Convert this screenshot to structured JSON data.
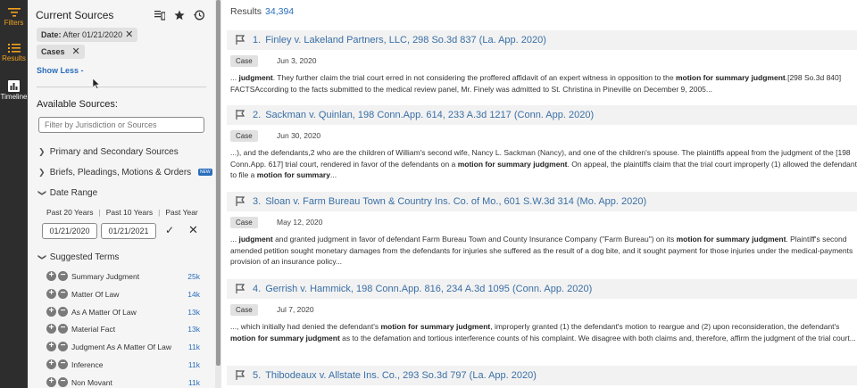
{
  "rail": {
    "items": [
      {
        "label": "Filters",
        "icon": "filter-icon",
        "active": true
      },
      {
        "label": "Results",
        "icon": "list-icon",
        "active": true
      },
      {
        "label": "Timeline",
        "icon": "chart-icon",
        "active": false
      }
    ]
  },
  "panel": {
    "title": "Current Sources",
    "chips": [
      {
        "label_bold": "Date:",
        "label": " After 01/21/2020"
      },
      {
        "label_bold": "Cases",
        "label": ""
      }
    ],
    "show_less": "Show Less -",
    "available_title": "Available Sources:",
    "filter_placeholder": "Filter by Jurisdiction or Sources",
    "accordions": [
      {
        "label": "Primary and Secondary Sources",
        "open": false
      },
      {
        "label": "Briefs, Pleadings, Motions & Orders",
        "open": false,
        "badge": "NEW"
      },
      {
        "label": "Date Range",
        "open": true
      }
    ],
    "date_range": {
      "links": [
        "Past 20 Years",
        "Past 10 Years",
        "Past Year"
      ],
      "from": "01/21/2020",
      "to": "01/21/2021"
    },
    "suggested": {
      "label": "Suggested Terms",
      "terms": [
        {
          "name": "Summary Judgment",
          "count": "25k"
        },
        {
          "name": "Matter Of Law",
          "count": "14k"
        },
        {
          "name": "As A Matter Of Law",
          "count": "13k"
        },
        {
          "name": "Material Fact",
          "count": "13k"
        },
        {
          "name": "Judgment As A Matter Of Law",
          "count": "11k"
        },
        {
          "name": "Inference",
          "count": "11k"
        },
        {
          "name": "Non Movant",
          "count": "11k"
        }
      ]
    }
  },
  "results": {
    "label": "Results",
    "count": "34,394",
    "items": [
      {
        "num": "1.",
        "title": "Finley v. Lakeland Partners, LLC, 298 So.3d 837 (La. App. 2020)",
        "type": "Case",
        "date": "Jun 3, 2020",
        "snippet_html": "... <b>judgment</b>. They further claim the trial court erred in not considering the proffered affidavit of an expert witness in opposition to the <b>motion for summary judgment</b>.[298 So.3d 840] FACTSAccording to the facts submitted to the medical review panel, Mr. Finely was admitted to St. Christina in Pineville on December 9, 2005..."
      },
      {
        "num": "2.",
        "title": "Sackman v. Quinlan, 198 Conn.App. 614, 233 A.3d 1217 (Conn. App. 2020)",
        "type": "Case",
        "date": "Jun 30, 2020",
        "snippet_html": "...), and the defendants,2 who are the children of William's second wife, Nancy L. Sackman (Nancy), and one of the children's spouse. The plaintiffs appeal from the judgment of the [198 Conn.App. 617] trial court, rendered in favor of the defendants on a <b>motion for summary judgment</b>. On appeal, the plaintiffs claim that the trial court improperly (1) allowed the defendants to file a <b>motion for summary</b>..."
      },
      {
        "num": "3.",
        "title": "Sloan v. Farm Bureau Town & Country Ins. Co. of Mo., 601 S.W.3d 314 (Mo. App. 2020)",
        "type": "Case",
        "date": "May 12, 2020",
        "snippet_html": "... <b>judgment</b> and granted judgment in favor of defendant Farm Bureau Town and County Insurance Company (\"Farm Bureau\") on its <b>motion for summary judgment</b>. Plaintiff's second amended petition sought monetary damages from the defendants for injuries she suffered as the result of a dog bite, and it sought payment for those injuries under the medical-payments provision of an insurance policy..."
      },
      {
        "num": "4.",
        "title": "Gerrish v. Hammick, 198 Conn.App. 816, 234 A.3d 1095 (Conn. App. 2020)",
        "type": "Case",
        "date": "Jul 7, 2020",
        "snippet_html": "..., which initially had denied the defendant's <b>motion for summary judgment</b>, improperly granted (1) the defendant's motion to reargue and (2) upon reconsideration, the defendant's <b>motion for summary judgment</b> as to the defamation and tortious interference counts of his complaint. We disagree with both claims and, therefore, affirm the judgment of the trial court..."
      },
      {
        "num": "5.",
        "title": "Thibodeaux v. Allstate Ins. Co., 293 So.3d 797 (La. App. 2020)",
        "type": "",
        "date": "",
        "snippet_html": ""
      }
    ]
  }
}
